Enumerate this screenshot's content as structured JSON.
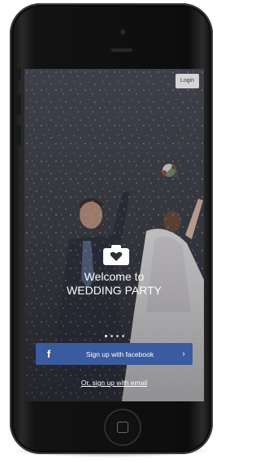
{
  "header": {
    "login_label": "Login"
  },
  "hero": {
    "welcome_line1": "Welcome to",
    "welcome_line2": "WEDDING PARTY"
  },
  "pager": {
    "total": 4,
    "active_index": 0
  },
  "actions": {
    "facebook_icon": "f",
    "facebook_label": "Sign up with facebook",
    "facebook_chevron": "›",
    "email_label": "Or, sign up with email"
  },
  "colors": {
    "facebook_blue": "#3b5ba0"
  }
}
